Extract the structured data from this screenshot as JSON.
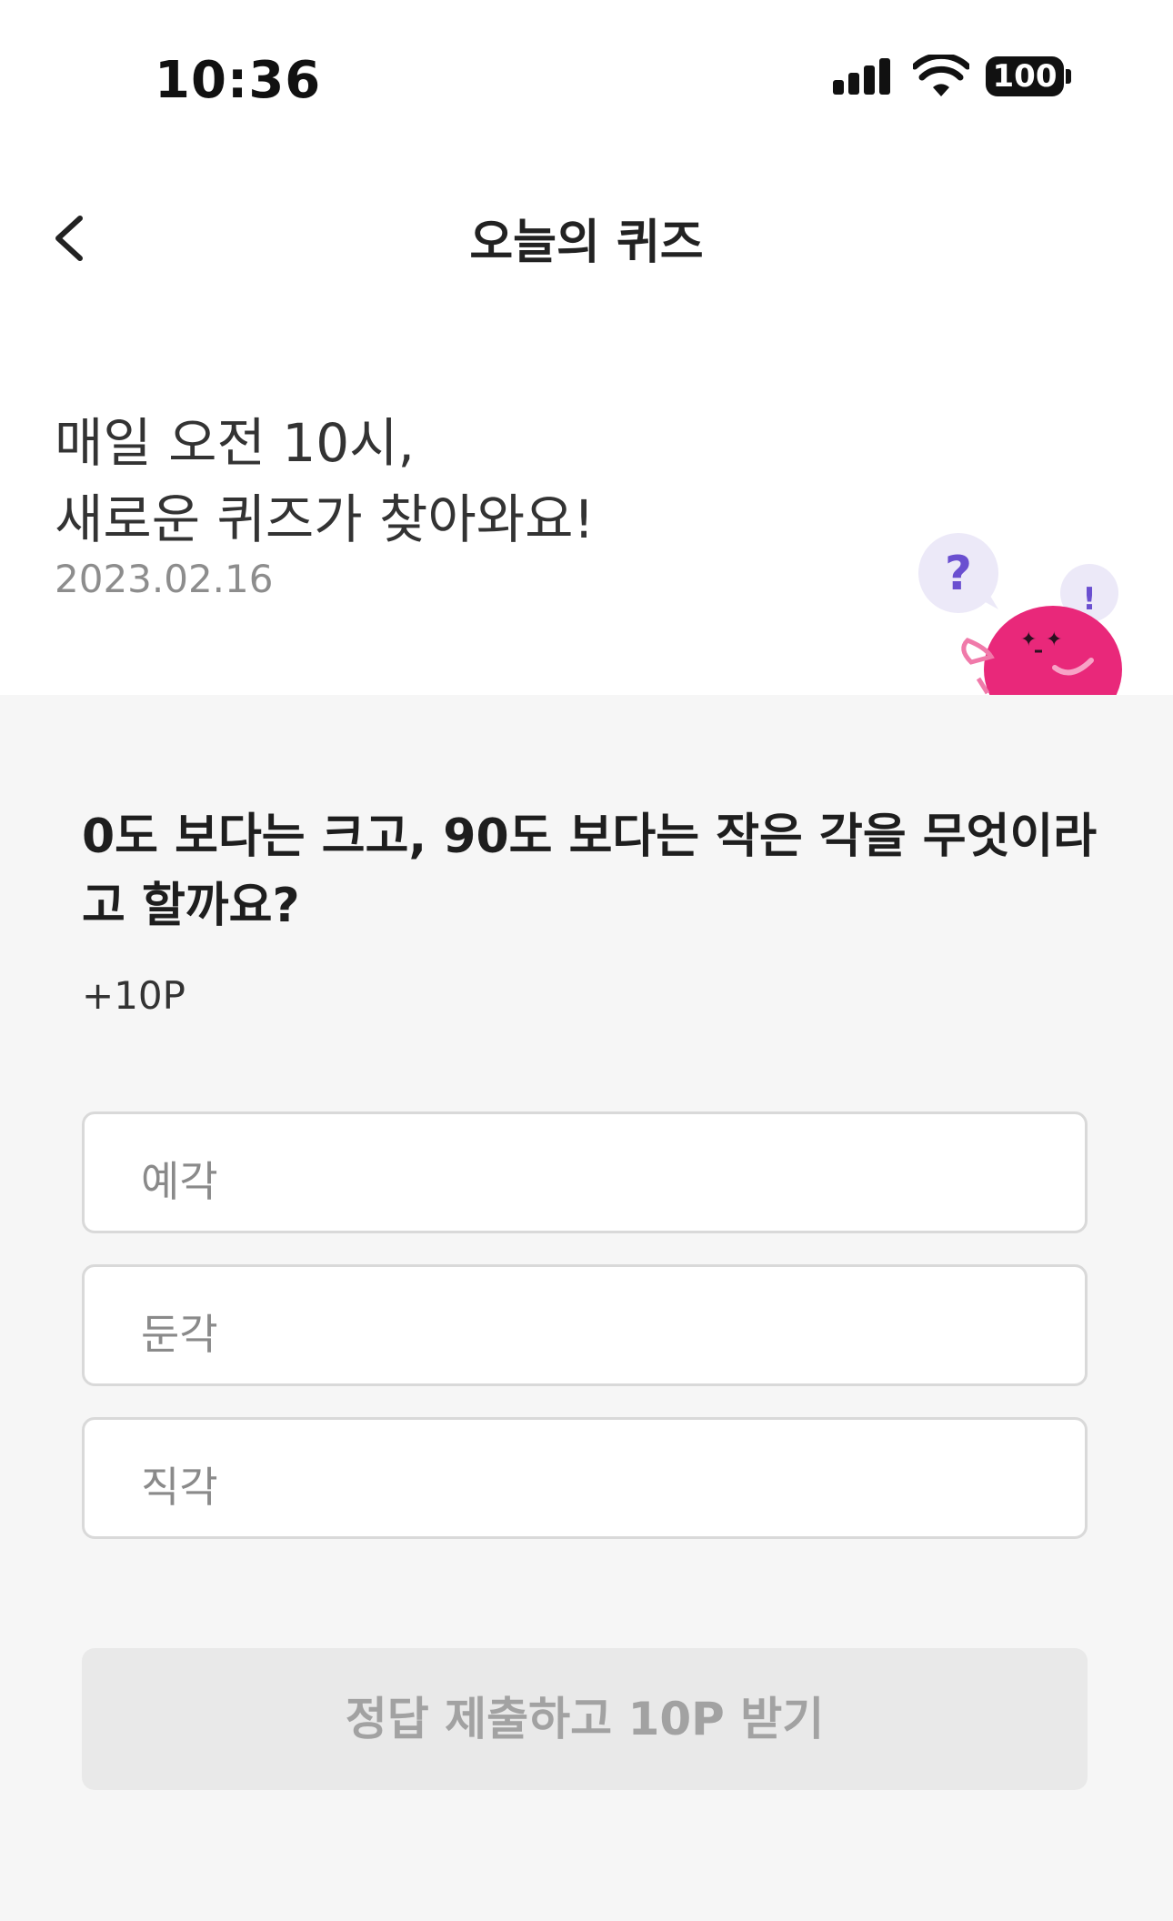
{
  "status_bar": {
    "time": "10:36",
    "battery": "100"
  },
  "header": {
    "title": "오늘의 퀴즈"
  },
  "hero": {
    "line1": "매일 오전 10시,",
    "line2": "새로운 퀴즈가 찾아와요!",
    "date": "2023.02.16"
  },
  "mascot": {
    "bubble_left": "?",
    "bubble_right": "!"
  },
  "quiz": {
    "question": "0도 보다는 크고, 90도 보다는 작은 각을 무엇이라고 할까요?",
    "points": "+10P",
    "options": [
      {
        "label": "예각"
      },
      {
        "label": "둔각"
      },
      {
        "label": "직각"
      }
    ],
    "submit_label": "정답 제출하고 10P 받기"
  },
  "colors": {
    "accent": "#e9287a",
    "bubble": "#ece9f8",
    "bubble_mark": "#6a4fd0"
  }
}
